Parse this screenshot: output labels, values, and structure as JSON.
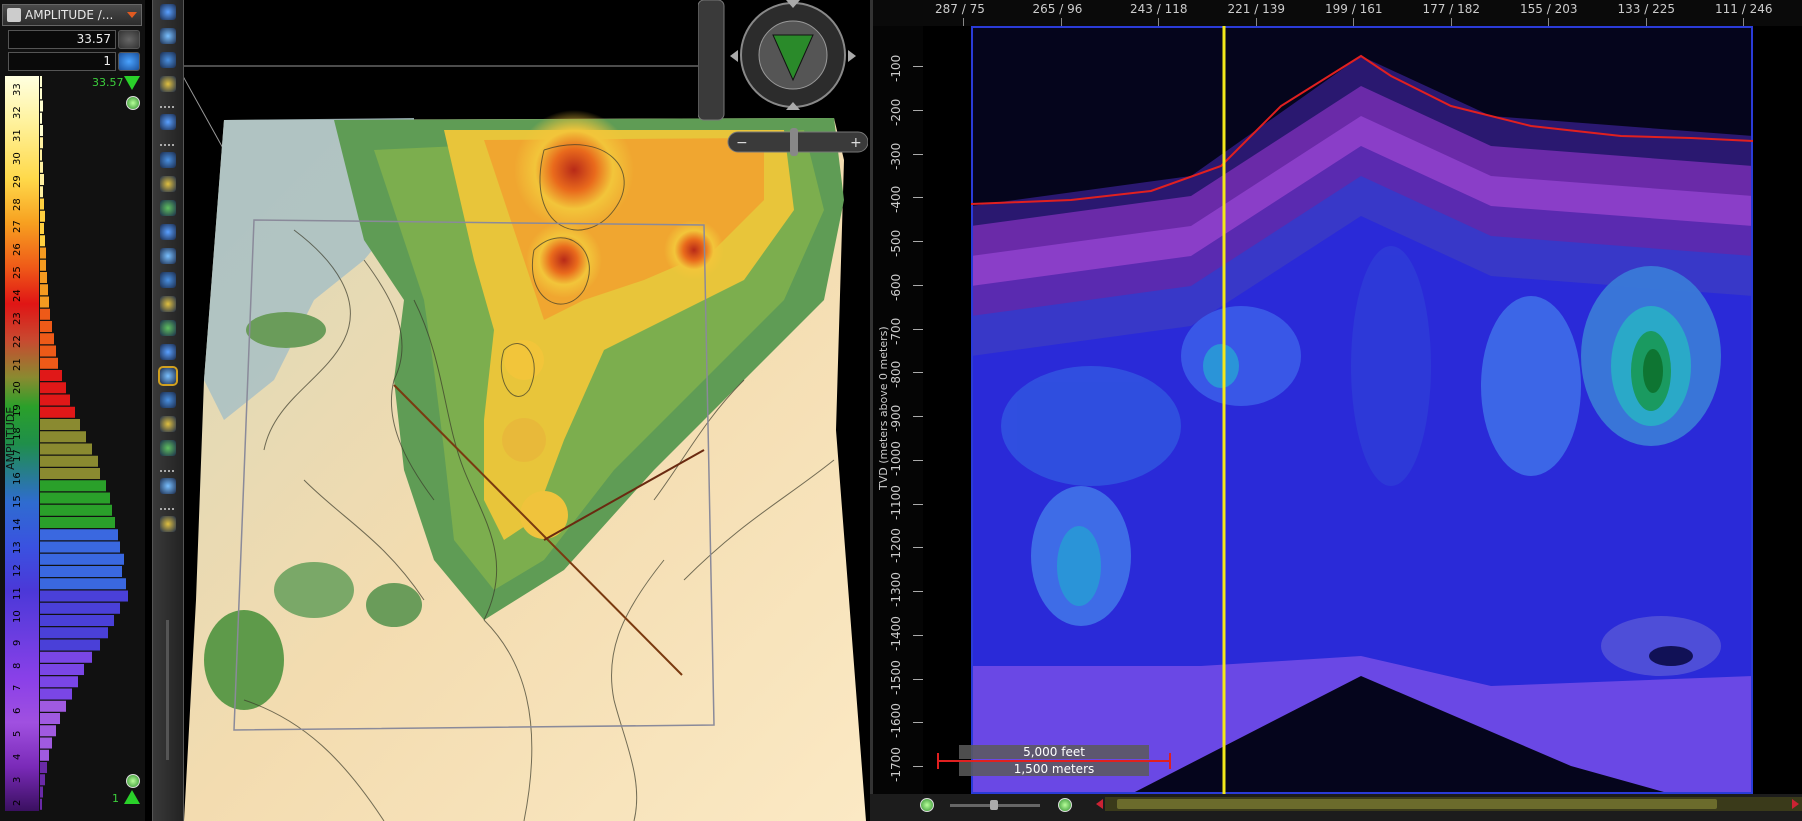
{
  "colorbar": {
    "attribute_label": "AMPLITUDE /...",
    "max_value": "33.57",
    "min_value": "1",
    "max_marker": "33.57",
    "min_marker": "1",
    "axis_label": "AMPLITUDE",
    "ticks": [
      "33",
      "32",
      "31",
      "30",
      "29",
      "28",
      "27",
      "26",
      "25",
      "24",
      "23",
      "22",
      "21",
      "20",
      "19",
      "18",
      "17",
      "16",
      "15",
      "14",
      "13",
      "12",
      "11",
      "10",
      "9",
      "8",
      "7",
      "6",
      "5",
      "4",
      "3",
      "2"
    ],
    "histogram": [
      2,
      2,
      3,
      2,
      3,
      3,
      2,
      3,
      4,
      3,
      4,
      5,
      4,
      5,
      6,
      6,
      7,
      8,
      9,
      10,
      12,
      14,
      16,
      18,
      22,
      26,
      30,
      35,
      40,
      46,
      52,
      58,
      60,
      66,
      70,
      72,
      75,
      78,
      80,
      84,
      82,
      86,
      88,
      80,
      74,
      68,
      60,
      52,
      44,
      38,
      32,
      26,
      20,
      16,
      12,
      9,
      7,
      5,
      3,
      2
    ]
  },
  "toolstrip": {
    "tools": [
      "zoom-icon",
      "zoom-in-icon",
      "rotate-icon",
      "axis-icon",
      "divider",
      "select-box-icon",
      "divider",
      "pick-icon",
      "cursor-icon",
      "edit-icon",
      "transform-icon",
      "layers-icon",
      "stack-icon",
      "tilt-icon",
      "pen-icon",
      "dish-icon",
      "surface-icon",
      "copy-icon",
      "square-icon",
      "grid-icon",
      "divider",
      "brush-icon",
      "divider",
      "zoom-fit-icon"
    ]
  },
  "section": {
    "top_axis_labels": [
      "287 / 75",
      "265 / 96",
      "243 / 118",
      "221 / 139",
      "199 / 161",
      "177 / 182",
      "155 / 203",
      "133 / 225",
      "111 / 246"
    ],
    "y_axis_title": "TVD (meters above 0 meters)",
    "y_ticks": [
      "-100",
      "-200",
      "-300",
      "-400",
      "-500",
      "-600",
      "-700",
      "-800",
      "-900",
      "-1000",
      "-1100",
      "-1200",
      "-1300",
      "-1400",
      "-1500",
      "-1600",
      "-1700"
    ],
    "scale_feet": "5,000 feet",
    "scale_meters": "1,500 meters",
    "colors": {
      "horizon": "#e02020",
      "well": "#f2e81a",
      "frame": "#2a3bd8"
    }
  }
}
